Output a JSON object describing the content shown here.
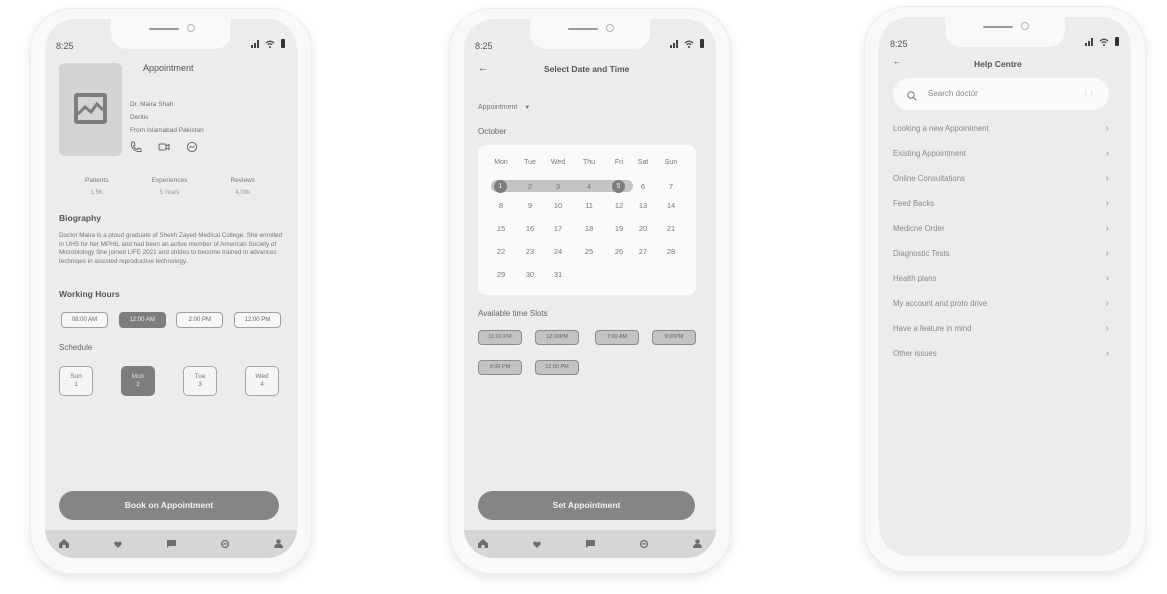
{
  "status_bar": {
    "time": "8:25"
  },
  "doctor_profile": {
    "title": "Appointment",
    "photo_icon": "image-placeholder-icon",
    "doctor_name": "Dr. Maira Shah",
    "specialty": "Deritis",
    "location": "From Islamabad Pakistan",
    "contact_icons": [
      "phone-icon",
      "video-icon",
      "messenger-icon"
    ],
    "stats": [
      {
        "label": "Patients",
        "value": "1.5K"
      },
      {
        "label": "Experiences",
        "value": "5 Years"
      },
      {
        "label": "Reviews",
        "value": "4.00k"
      }
    ],
    "biography_heading": "Biography",
    "biography_text": "Doctor Maira is a ptoud graduate of Shekh Zayed Medical College. She enrolled in UHS for her MPHIL and had been an active member of American Society of Microbiology She joined LIFE 2021 and strides to become trained in advancec techniqes in assisted reproductive technology.",
    "working_hours_heading": "Working Hours",
    "working_hours": [
      {
        "label": "08:00 AM",
        "selected": false
      },
      {
        "label": "12:00 AM",
        "selected": true
      },
      {
        "label": "2:00 PM",
        "selected": false
      },
      {
        "label": "12:00 PM",
        "selected": false
      }
    ],
    "schedule_heading": "Schedule",
    "schedule_days": [
      {
        "day": "Sun",
        "date": "1",
        "selected": false
      },
      {
        "day": "Mon",
        "date": "2",
        "selected": true
      },
      {
        "day": "Tue",
        "date": "3",
        "selected": false
      },
      {
        "day": "Wed",
        "date": "4",
        "selected": false
      }
    ],
    "cta_label": "Book on Appointment"
  },
  "date_time": {
    "title": "Select Date and Time",
    "dropdown_label": "Appointment",
    "month": "October",
    "weekdays": [
      "Mon",
      "Tue",
      "Wed",
      "Thu",
      "Fri",
      "Sat",
      "Sun"
    ],
    "days": [
      "1",
      "2",
      "3",
      "4",
      "5",
      "6",
      "7",
      "8",
      "9",
      "10",
      "11",
      "12",
      "13",
      "14",
      "15",
      "16",
      "17",
      "18",
      "19",
      "20",
      "21",
      "22",
      "23",
      "24",
      "25",
      "26",
      "27",
      "28",
      "29",
      "30",
      "31"
    ],
    "range_start": "1",
    "range_end": "5",
    "slots_heading": "Available time Slots",
    "slots": [
      "11:00 PM",
      "12:00PM",
      "7:00 AM",
      "9:00PM",
      "8:00 PM",
      "12:00 PM"
    ],
    "cta_label": "Set Appointment"
  },
  "help_centre": {
    "title": "Help Centre",
    "search_placeholder": "Search doctor",
    "items": [
      "Looking a new Appointment",
      "Existing Appointment",
      "Online Consultations",
      "Feed Backs",
      "Medicne Order",
      "Diagnostic Tests",
      "Health plans",
      "My account and proto drive",
      "Have a feature in mind",
      "Other issues"
    ]
  },
  "tabbar": {
    "icons": [
      "home-icon",
      "heart-icon",
      "chat-icon",
      "messenger-icon",
      "profile-icon"
    ]
  },
  "colors": {
    "screen_bg": "#ececec",
    "accent_gray": "#7d7d7d",
    "button_gray": "#858585",
    "tabbar_bg": "#d6d6d6"
  }
}
